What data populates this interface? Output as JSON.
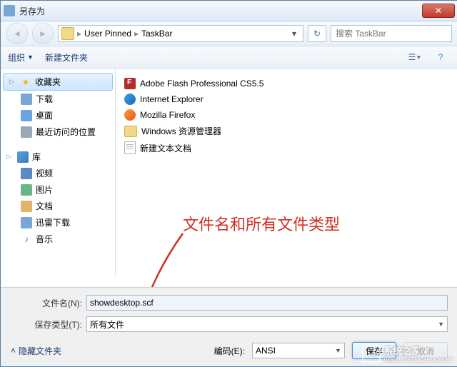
{
  "window": {
    "title": "另存为"
  },
  "nav": {
    "breadcrumb": [
      "User Pinned",
      "TaskBar"
    ],
    "search_placeholder": "搜索 TaskBar"
  },
  "toolbar": {
    "organize": "组织",
    "new_folder": "新建文件夹"
  },
  "sidebar": {
    "favorites": {
      "label": "收藏夹",
      "items": [
        "下载",
        "桌面",
        "最近访问的位置"
      ]
    },
    "libraries": {
      "label": "库",
      "items": [
        "视频",
        "图片",
        "文档",
        "迅雷下载",
        "音乐"
      ]
    }
  },
  "files": [
    {
      "name": "Adobe Flash Professional CS5.5",
      "icon": "flash"
    },
    {
      "name": "Internet Explorer",
      "icon": "ie"
    },
    {
      "name": "Mozilla Firefox",
      "icon": "ff"
    },
    {
      "name": "Windows 资源管理器",
      "icon": "explorer"
    },
    {
      "name": "新建文本文档",
      "icon": "txt"
    }
  ],
  "annotation": "文件名和所有文件类型",
  "bottom": {
    "filename_label": "文件名(N):",
    "filename_value": "showdesktop.scf",
    "filetype_label": "保存类型(T):",
    "filetype_value": "所有文件",
    "hide_folders": "隐藏文件夹",
    "encoding_label": "编码(E):",
    "encoding_value": "ANSI",
    "save_btn": "保存",
    "cancel_btn": "取消"
  },
  "watermark": {
    "text": "系统之家",
    "url": "WWW.XITONGZHIJIA.NET"
  }
}
